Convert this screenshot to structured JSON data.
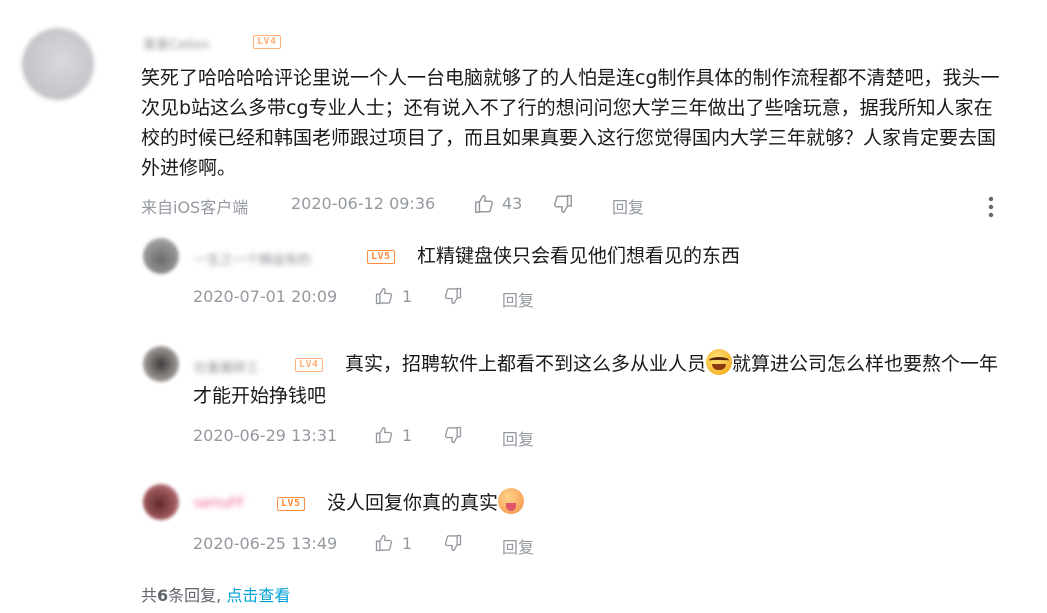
{
  "main_comment": {
    "username": "某某Cellon",
    "level": "LV4",
    "text": "笑死了哈哈哈哈评论里说一个人一台电脑就够了的人怕是连cg制作具体的制作流程都不清楚吧，我头一次见b站这么多带cg专业人士；还有说入不了行的想问问您大学三年做出了些啥玩意，据我所知人家在校的时候已经和韩国老师跟过项目了，而且如果真要入这行您觉得国内大学三年就够？人家肯定要去国外进修啊。",
    "source": "来自iOS客户端",
    "time": "2020-06-12 09:36",
    "likes": "43",
    "reply_label": "回复",
    "more_icon": "vertical-ellipsis-icon"
  },
  "replies": [
    {
      "username": "一生之一个精益有的",
      "level": "LV5",
      "text": "杠精键盘侠只会看见他们想看见的东西",
      "time": "2020-07-01 20:09",
      "likes": "1",
      "reply_label": "回复"
    },
    {
      "username": "社畜搬砖工",
      "level": "LV4",
      "text_before": "真实，招聘软件上都看不到这么多从业人员",
      "text_after": "就算进公司怎么样也要熬个一年才能开始挣钱吧",
      "emoji": "laugh-cry-emoji",
      "time": "2020-06-29 13:31",
      "likes": "1",
      "reply_label": "回复"
    },
    {
      "username": "samuFF",
      "level": "LV5",
      "text": "没人回复你真的真实",
      "emoji": "tongue-face-emoji",
      "time": "2020-06-25 13:49",
      "likes": "1",
      "reply_label": "回复"
    }
  ],
  "footer": {
    "prefix": "共",
    "count": "6",
    "suffix": "条回复,",
    "link": "点击查看"
  },
  "colors": {
    "text": "#18191c",
    "meta": "#9499a0",
    "link": "#00a1d6",
    "lv4": "#feb17a",
    "lv5": "#ff8c3e",
    "vip_name": "#f25d8e"
  }
}
